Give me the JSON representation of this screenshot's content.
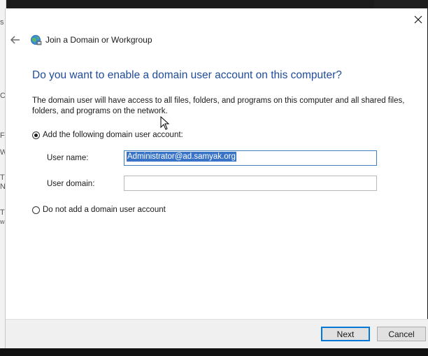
{
  "background": {
    "fragments": [
      "s",
      "C",
      "F",
      "W",
      "T",
      "N",
      "T",
      "w"
    ]
  },
  "window": {
    "title": "Join a Domain or Workgroup",
    "icons": {
      "close": "close-icon",
      "back": "back-arrow-icon",
      "wizard": "network-globe-icon"
    }
  },
  "main": {
    "heading": "Do you want to enable a domain user account on this computer?",
    "description": "The domain user will have access to all files, folders, and programs on this computer and all shared files, folders, and programs on the network."
  },
  "options": {
    "add_account_label": "Add the following domain user account:",
    "add_account_selected": true,
    "no_account_label": "Do not add a domain user account",
    "no_account_selected": false
  },
  "fields": {
    "username_label": "User name:",
    "username_value": "Administrator@ad.samyak.org",
    "domain_label": "User domain:",
    "domain_value": ""
  },
  "footer": {
    "next_label": "Next",
    "cancel_label": "Cancel"
  },
  "colors": {
    "heading": "#1f4b99",
    "selection": "#3873c7",
    "default_button_border": "#0078d7"
  }
}
